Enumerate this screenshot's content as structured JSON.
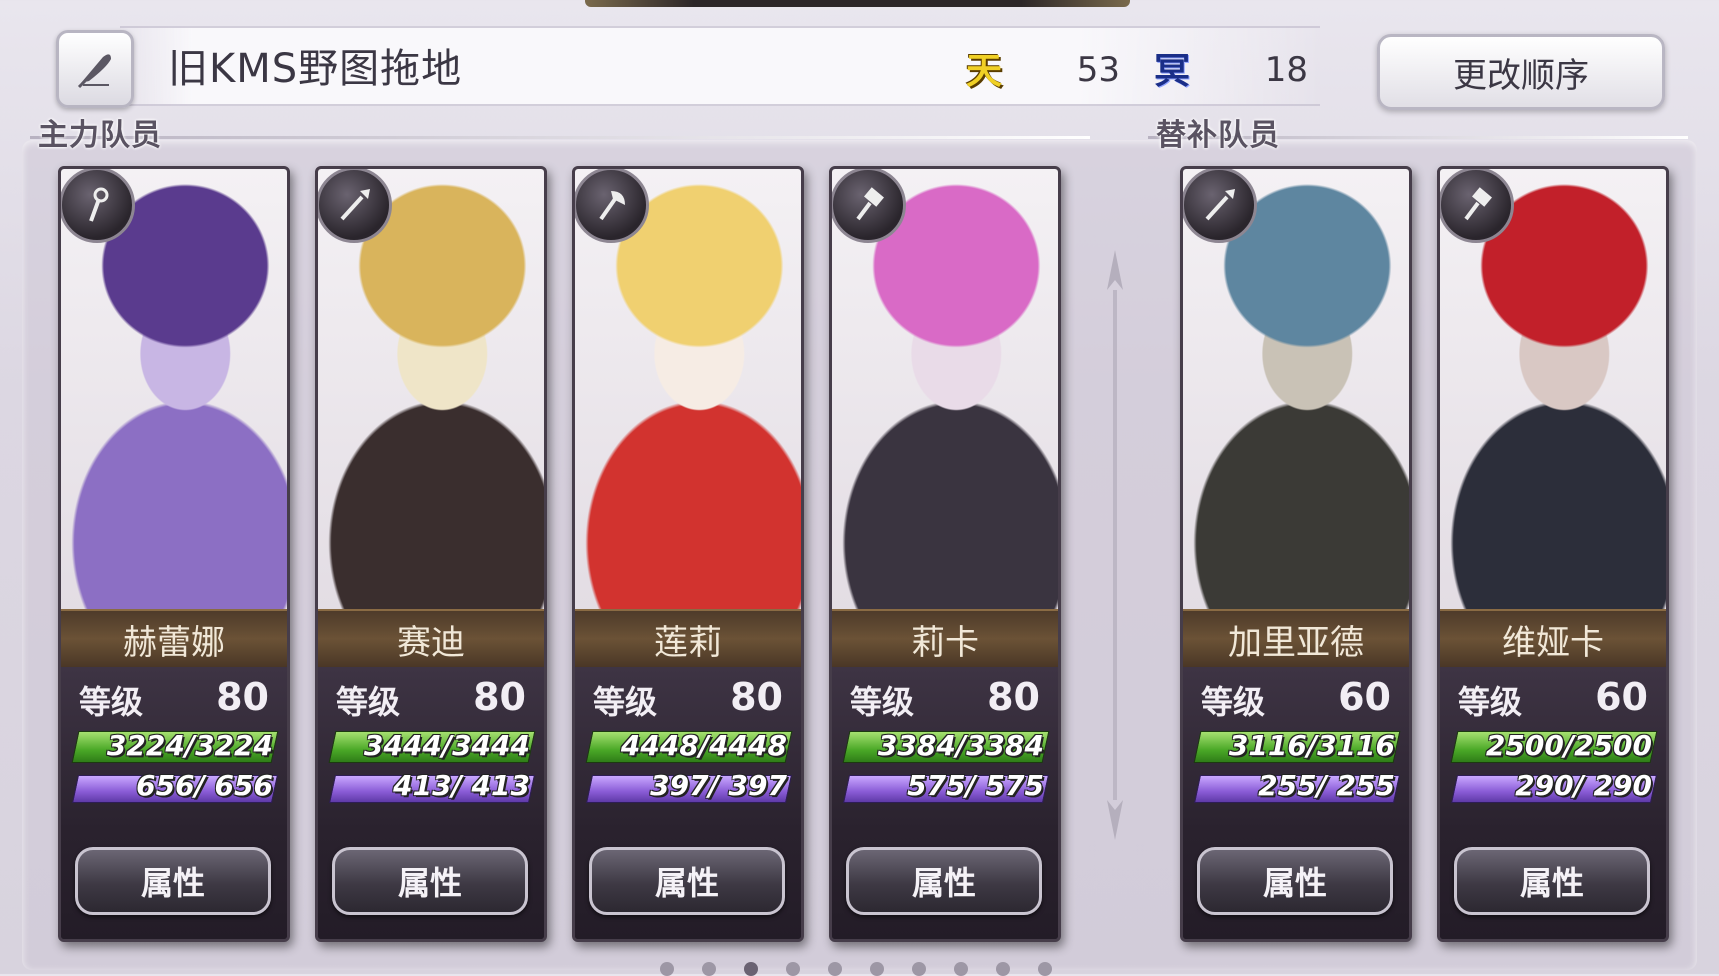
{
  "team": {
    "name": "旧KMS野图拖地",
    "edit_icon": "feather-quill-icon",
    "sky_badge": "天",
    "sky_count": "53",
    "dark_badge": "冥",
    "dark_count": "18",
    "reorder_label": "更改顺序"
  },
  "sections": {
    "main_label": "主力队员",
    "sub_label": "替补队员"
  },
  "level_label": "等级",
  "attr_label": "属性",
  "members": [
    {
      "name": "赫蕾娜",
      "level": "80",
      "hp": "3224/3224",
      "mp": "656/ 656",
      "class_icon": "staff-icon",
      "colors": [
        "#5a3b8e",
        "#8c6fc4",
        "#c8b6e4"
      ]
    },
    {
      "name": "赛迪",
      "level": "80",
      "hp": "3444/3444",
      "mp": "413/ 413",
      "class_icon": "spear-icon",
      "colors": [
        "#d9b45c",
        "#3a2e2e",
        "#efe5c8"
      ]
    },
    {
      "name": "莲莉",
      "level": "80",
      "hp": "4448/4448",
      "mp": "397/ 397",
      "class_icon": "axe-icon",
      "colors": [
        "#f0d070",
        "#d2332f",
        "#f6ece4"
      ]
    },
    {
      "name": "莉卡",
      "level": "80",
      "hp": "3384/3384",
      "mp": "575/ 575",
      "class_icon": "hammer-icon",
      "colors": [
        "#d96ac6",
        "#3a3440",
        "#e9dbe8"
      ]
    }
  ],
  "reserves": [
    {
      "name": "加里亚德",
      "level": "60",
      "hp": "3116/3116",
      "mp": "255/ 255",
      "class_icon": "spear-icon",
      "colors": [
        "#5e86a0",
        "#3b3a36",
        "#c9c2b6"
      ]
    },
    {
      "name": "维娅卡",
      "level": "60",
      "hp": "2500/2500",
      "mp": "290/ 290",
      "class_icon": "hammer-icon",
      "colors": [
        "#c2202a",
        "#2c2e3a",
        "#d9c8c4"
      ]
    }
  ]
}
